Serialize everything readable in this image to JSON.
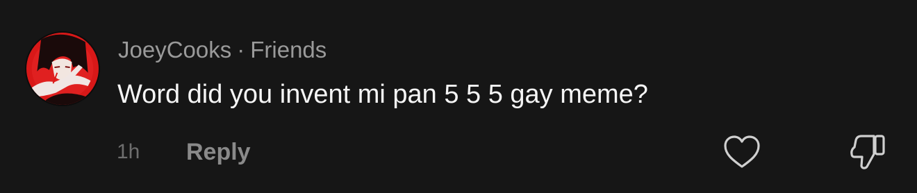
{
  "comment": {
    "author": "JoeyCooks",
    "separator": "·",
    "relationship": "Friends",
    "text": "Word did you invent mi pan 5 5 5 gay meme?",
    "timestamp": "1h",
    "reply_label": "Reply",
    "avatar_icon": "avatar-anime-character",
    "like_icon": "heart-outline-icon",
    "dislike_icon": "thumbs-down-outline-icon"
  },
  "colors": {
    "background": "#161616",
    "text_primary": "#f5f5f5",
    "text_secondary": "#9a9a9a",
    "text_muted": "#6e6e6e",
    "avatar_red": "#d81818"
  }
}
